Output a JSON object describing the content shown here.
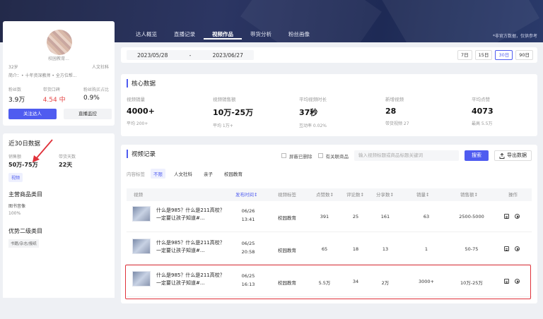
{
  "profile": {
    "name": "校园教育...",
    "age": "32岁",
    "category": "人文社科",
    "intro_label": "简介：",
    "intro_text": "• 十年资深教师 • 全方位帮...",
    "stats": [
      {
        "label": "粉丝数",
        "value": "3.9万",
        "red": false
      },
      {
        "label": "带货口碑",
        "value": "4.54 中",
        "red": true
      },
      {
        "label": "粉丝购买占比",
        "value": "0.9%",
        "red": false
      }
    ],
    "follow_button": "关注达人",
    "monitor_button": "直播监控"
  },
  "recent30": {
    "title": "近30日数据",
    "sales_label": "销售额",
    "sales_value": "50万-75万",
    "days_label": "带货天数",
    "days_value": "22天",
    "chip": "视频"
  },
  "categories": {
    "main_title": "主营商品类目",
    "main_item": "图书音像",
    "main_pct": "100%",
    "secondary_title": "优势二级类目",
    "secondary_chip": "书籍/杂志/报纸"
  },
  "tabs": [
    "达人概览",
    "直播记录",
    "视频作品",
    "带货分析",
    "粉丝画像"
  ],
  "active_tab": 2,
  "disclaimer": "*非官方数据，仅供参考",
  "date": {
    "start": "2023/05/28",
    "sep": "-",
    "end": "2023/06/27",
    "periods": [
      "7日",
      "15日",
      "30日",
      "90日"
    ],
    "active_period": 2
  },
  "core": {
    "title": "核心数据",
    "metrics": [
      {
        "label": "视频销量",
        "value": "4000+",
        "sub": "平均 200+"
      },
      {
        "label": "视频销售额",
        "value": "10万-25万",
        "sub": "平均 1万+"
      },
      {
        "label": "平均视频时长",
        "value": "37秒",
        "sub": "互动率 0.02%"
      },
      {
        "label": "新增视频",
        "value": "28",
        "sub": "带货视频 27"
      },
      {
        "label": "平均点赞",
        "value": "4073",
        "sub": "最高 5.5万"
      }
    ]
  },
  "records": {
    "title": "视频记录",
    "chk_deleted": "屏蔽已删除",
    "chk_linked": "有关联商品",
    "search_placeholder": "输入视频标题或商品标题关键词",
    "search_button": "搜索",
    "export_button": "导出数据",
    "filter_label": "内容标签",
    "filters": [
      "不限",
      "人文社科",
      "亲子",
      "校园教育"
    ],
    "active_filter": 0,
    "columns": [
      "视频",
      "发布时间↕",
      "视频标签",
      "点赞数↕",
      "评论数↕",
      "分享数↕",
      "销量↕",
      "销售额↕",
      "操作"
    ],
    "rows": [
      {
        "title": "什么是985？什么是211高校？一定要让孩子知道#...",
        "date": "06/26",
        "time": "13:41",
        "tag": "校园教育",
        "likes": "391",
        "comments": "25",
        "shares": "161",
        "sales": "63",
        "amount": "2500-5000"
      },
      {
        "title": "什么是985？什么是211高校？一定要让孩子知道#...",
        "date": "06/25",
        "time": "20:58",
        "tag": "校园教育",
        "likes": "65",
        "comments": "18",
        "shares": "13",
        "sales": "1",
        "amount": "50-75"
      },
      {
        "title": "什么是985？什么是211高校？一定要让孩子知道#...",
        "date": "06/25",
        "time": "16:13",
        "tag": "校园教育",
        "likes": "5.5万",
        "comments": "34",
        "shares": "2万",
        "sales": "3000+",
        "amount": "10万-25万"
      }
    ]
  },
  "colors": {
    "accent": "#4f5cf0",
    "highlight": "#e0313a",
    "negative": "#e54545"
  }
}
